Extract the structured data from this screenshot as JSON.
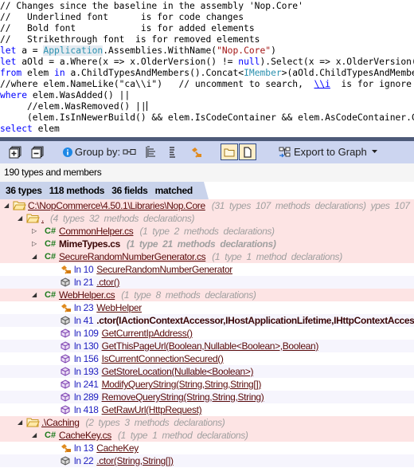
{
  "code_editor": {
    "lines": [
      "// Changes since the baseline in the assembly 'Nop.Core'",
      "//   Underlined font      is for code changes",
      "//   Bold font            is for added elements",
      "//   Strikethrough font  is for removed elements",
      "let a = Application.Assemblies.WithName(\"Nop.Core\")",
      "let aOld = a.Where(x => x.OlderVersion() != null).Select(x => x.OlderVersion())",
      "from elem in a.ChildTypesAndMembers().Concat<IMember>(aOld.ChildTypesAndMembers())",
      "//where elem.NameLike(\"ca\\\\i\")   // uncomment to search,  \\\\i  is for ignore case",
      "where elem.WasAdded() ||",
      "     //elem.WasRemoved() ||",
      "     (elem.IsInNewerBuild() && elem.IsCodeContainer && elem.AsCodeContainer.CodeWasChanged())",
      "select elem"
    ],
    "tokens": {
      "l0": "// Changes since the baseline in the assembly 'Nop.Core'",
      "l1": "//   Underlined font      is for code changes",
      "l2": "//   Bold font            is for added elements",
      "l3": "//   Strikethrough font  is for removed elements",
      "let": "let",
      "l4a": " a = ",
      "l4b": "Application",
      "l4c": ".Assemblies.WithName(",
      "l4d": "\"Nop.Core\"",
      "l4e": ")",
      "l5a": " aOld = a.Where(x => x.OlderVersion() != ",
      "null": "null",
      "l5b": ").Select(x => x.OlderVersion())",
      "from": "from",
      "l6a": " elem ",
      "in": "in",
      "l6b": " a.ChildTypesAndMembers().Concat<",
      "l6c": "IMember",
      "l6d": ">(aOld.ChildTypesAndMembers())",
      "l7a": "//where elem.NameLike(\"ca\\\\i\")   // uncomment to search,  ",
      "l7b": "\\\\i",
      "l7c": "  is for ignore case",
      "where": "where",
      "l8a": " elem.WasAdded() ||",
      "l9a": "     //elem.WasRemoved() ||",
      "l10a": "     (elem.IsInNewerBuild() && elem.IsCodeContainer && elem.AsCodeContainer.CodeWasChanged())",
      "select": "select",
      "l11a": " elem"
    }
  },
  "toolbar": {
    "expand_all_icon": "expand-all-icon",
    "collapse_all_icon": "collapse-all-icon",
    "info_icon": "info-icon",
    "group_by_label": "Group by:",
    "group_options": [
      "flat-icon",
      "tree-hierarchy-icon",
      "list-icon",
      "type-icon"
    ],
    "toggle_folder_icon": "folder-icon",
    "toggle_file_icon": "file-icon",
    "export_label": "Export to Graph",
    "export_dropdown_icon": "caret-down-icon"
  },
  "status": {
    "count_text": "190 types and members"
  },
  "summary": {
    "text": "36 types   118 methods   36 fields   matched"
  },
  "tree": {
    "rows": [
      {
        "kind": "folder",
        "level": 0,
        "expanded": true,
        "name": "C:\\NopCommerce\\4.50.1\\Libraries\\Nop.Core",
        "meta": "(31 types   107 methods   declarations)  ypes   107",
        "style": "underline"
      },
      {
        "kind": "folder",
        "level": 1,
        "expanded": true,
        "name": ".",
        "meta": "(4 types   32 methods   declarations)",
        "style": "underline"
      },
      {
        "kind": "file",
        "level": 2,
        "expanded": false,
        "name": "CommonHelper.cs",
        "meta": "(1 type   2 methods   declarations)",
        "style": "underline"
      },
      {
        "kind": "file",
        "level": 2,
        "expanded": false,
        "name": "MimeTypes.cs",
        "meta": "(1 type   21 methods   declarations)",
        "style": "bold"
      },
      {
        "kind": "file",
        "level": 2,
        "expanded": true,
        "name": "SecureRandomNumberGenerator.cs",
        "meta": "(1 type   1 method   declarations)",
        "style": "underline"
      },
      {
        "kind": "type",
        "line": "ln 10",
        "name": "SecureRandomNumberGenerator",
        "style": "underline"
      },
      {
        "kind": "ctor",
        "line": "ln 21",
        "name": ".ctor()",
        "style": "underline"
      },
      {
        "kind": "file",
        "level": 2,
        "expanded": true,
        "name": "WebHelper.cs",
        "meta": "(1 type   8 methods   declarations)",
        "style": "underline"
      },
      {
        "kind": "type",
        "line": "ln 23",
        "name": "WebHelper",
        "style": "underline"
      },
      {
        "kind": "ctor",
        "line": "ln 41",
        "name": ".ctor(IActionContextAccessor,IHostApplicationLifetime,IHttpContextAccessor,...)",
        "style": "bold"
      },
      {
        "kind": "method",
        "line": "ln 109",
        "name": "GetCurrentIpAddress()",
        "style": "underline"
      },
      {
        "kind": "method",
        "line": "ln 130",
        "name": "GetThisPageUrl(Boolean,Nullable<Boolean>,Boolean)",
        "style": "underline"
      },
      {
        "kind": "method",
        "line": "ln 156",
        "name": "IsCurrentConnectionSecured()",
        "style": "underline"
      },
      {
        "kind": "method",
        "line": "ln 193",
        "name": "GetStoreLocation(Nullable<Boolean>)",
        "style": "underline"
      },
      {
        "kind": "method",
        "line": "ln 241",
        "name": "ModifyQueryString(String,String,String[])",
        "style": "underline"
      },
      {
        "kind": "method",
        "line": "ln 289",
        "name": "RemoveQueryString(String,String,String)",
        "style": "underline"
      },
      {
        "kind": "method",
        "line": "ln 418",
        "name": "GetRawUrl(HttpRequest)",
        "style": "underline"
      },
      {
        "kind": "folder",
        "level": 1,
        "expanded": true,
        "name": ".\\Caching",
        "meta": "(2 types   3 methods   declarations)",
        "style": "underline"
      },
      {
        "kind": "file",
        "level": 2,
        "expanded": true,
        "name": "CacheKey.cs",
        "meta": "(1 type   1 method   declarations)",
        "style": "underline"
      },
      {
        "kind": "type",
        "line": "ln 13",
        "name": "CacheKey",
        "style": "underline"
      },
      {
        "kind": "ctor",
        "line": "ln 22",
        "name": ".ctor(String,String[])",
        "style": "underline"
      }
    ],
    "cs_label": "C#"
  },
  "colors": {
    "toolbar_bg": "#ccd5f0",
    "header_strip": "#4d5a78",
    "pink_row": "#fde4e4",
    "alt_row": "#f6f5fd",
    "code_comment": "#008000",
    "code_keyword": "#0000ff",
    "code_type": "#2b91af",
    "code_string": "#a31515"
  }
}
